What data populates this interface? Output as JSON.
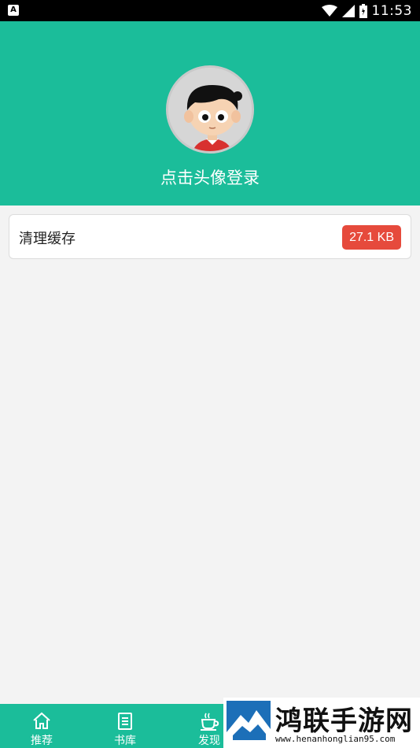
{
  "status_bar": {
    "left_icon": "A",
    "time": "11:53",
    "icons": [
      "wifi-icon",
      "signal-icon",
      "battery-icon"
    ]
  },
  "header": {
    "background": "#1bbd9a",
    "login_text": "点击头像登录"
  },
  "cache": {
    "label": "清理缓存",
    "size": "27.1 KB",
    "badge_color": "#e64a3c"
  },
  "bottom_nav": {
    "items": [
      {
        "label": "推荐",
        "icon": "home-icon"
      },
      {
        "label": "书库",
        "icon": "book-icon"
      },
      {
        "label": "发现",
        "icon": "coffee-icon"
      }
    ]
  },
  "watermark": {
    "title": "鸿联手游网",
    "url": "www.henanhonglian95.com"
  }
}
